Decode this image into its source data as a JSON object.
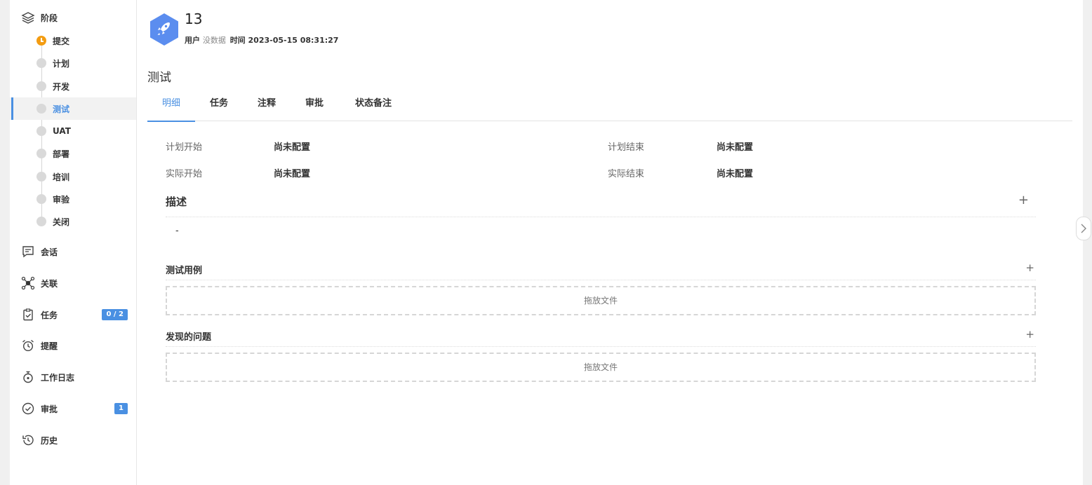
{
  "sidebar": {
    "stages_label": "阶段",
    "stages": [
      {
        "label": "提交",
        "current": true
      },
      {
        "label": "计划"
      },
      {
        "label": "开发"
      },
      {
        "label": "测试",
        "active": true
      },
      {
        "label": "UAT"
      },
      {
        "label": "部署"
      },
      {
        "label": "培训"
      },
      {
        "label": "审验"
      },
      {
        "label": "关闭"
      }
    ],
    "items": [
      {
        "label": "会话",
        "icon": "chat-icon"
      },
      {
        "label": "关联",
        "icon": "network-icon"
      },
      {
        "label": "任务",
        "icon": "clipboard-icon",
        "badge": "0 / 2"
      },
      {
        "label": "提醒",
        "icon": "alarm-clock-icon"
      },
      {
        "label": "工作日志",
        "icon": "stopwatch-icon"
      },
      {
        "label": "审批",
        "icon": "check-circle-icon",
        "badge": "1"
      },
      {
        "label": "历史",
        "icon": "history-icon"
      }
    ]
  },
  "header": {
    "title": "13",
    "user_label": "用户",
    "user_value": "没数据",
    "time_label": "时间",
    "time_value": "2023-05-15 08:31:27",
    "icon": "rocket-icon",
    "accent": "#5b8def"
  },
  "stage_title": "测试",
  "tabs": [
    "明细",
    "任务",
    "注释",
    "审批",
    "状态备注"
  ],
  "fields": {
    "plan_start_label": "计划开始",
    "plan_start_value": "尚未配置",
    "plan_end_label": "计划结束",
    "plan_end_value": "尚未配置",
    "actual_start_label": "实际开始",
    "actual_start_value": "尚未配置",
    "actual_end_label": "实际结束",
    "actual_end_value": "尚未配置"
  },
  "description": {
    "title": "描述",
    "value": "-"
  },
  "test_cases": {
    "title": "测试用例",
    "dropzone": "拖放文件"
  },
  "issues": {
    "title": "发现的问题",
    "dropzone": "拖放文件"
  },
  "colors": {
    "accent": "#4a90e2",
    "current_stage": "#f39c12"
  }
}
